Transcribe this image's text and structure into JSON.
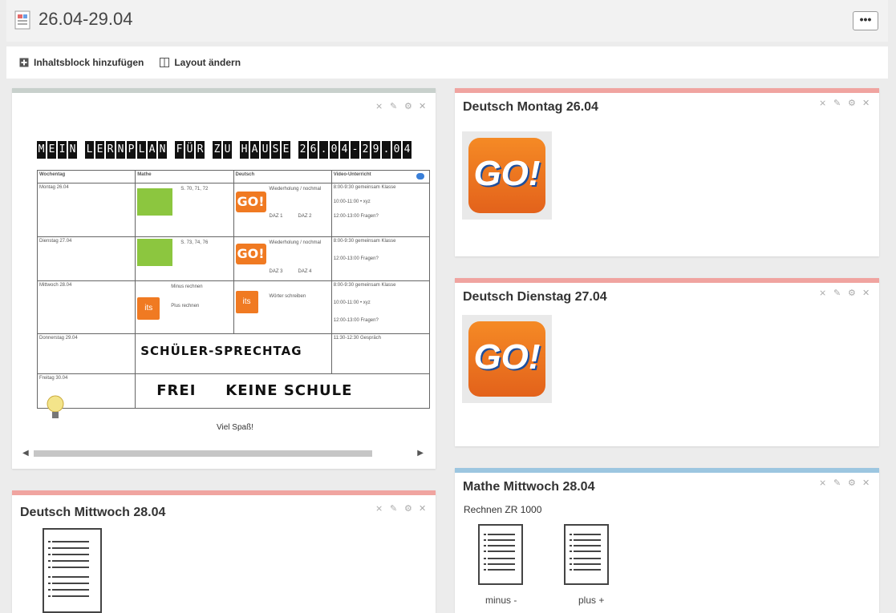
{
  "page": {
    "title": "26.04-29.04",
    "more_label": "•••"
  },
  "toolbar": {
    "add_block": "Inhaltsblock hinzufügen",
    "change_layout": "Layout ändern"
  },
  "colors": {
    "gray_bar": "#c8d0cc",
    "red_bar": "#f0a4a0",
    "blue_bar": "#9cc6e0",
    "orange": "#f07a22"
  },
  "plan_block": {
    "banner": [
      "M",
      "E",
      "I",
      "N",
      " ",
      "L",
      "E",
      "R",
      "N",
      "P",
      "L",
      "A",
      "N",
      " ",
      "F",
      "Ü",
      "R",
      " ",
      "Z",
      "U",
      " ",
      "H",
      "A",
      "U",
      "S",
      "E",
      " ",
      "2",
      "6",
      ".",
      "0",
      "4",
      "-",
      "2",
      "9",
      ".",
      "0",
      "4"
    ],
    "headers": [
      "Wochentag",
      "Mathe",
      "Deutsch",
      "Video-Unterricht"
    ],
    "rows": [
      {
        "day": "Montag 26.04",
        "mathe": "S. 70, 71, 72",
        "deutsch": "Wiederholung / nochmal",
        "daz": [
          "DAZ 1",
          "DAZ 2"
        ],
        "video": [
          "8:00-9:30 gemeinsam Klasse",
          "10:00-11:00 • xyz",
          "12:00-13:00 Fragen?"
        ]
      },
      {
        "day": "Dienstag 27.04",
        "mathe": "S. 73, 74, 76",
        "deutsch": "Wiederholung / nochmal",
        "daz": [
          "DAZ 3",
          "DAZ 4"
        ],
        "video": [
          "8:00-9:30 gemeinsam Klasse",
          "12:00-13:00 Fragen?"
        ]
      },
      {
        "day": "Mittwoch 28.04",
        "mathe_lines": [
          "Minus rechnen",
          "Plus rechnen"
        ],
        "deutsch": "Wörter schreiben",
        "video": [
          "8:00-9:30 gemeinsam Klasse",
          "10:00-11:00 • xyz",
          "12:00-13:00 Fragen?"
        ]
      },
      {
        "day": "Donnerstag 29.04",
        "big": "SCHÜLER-SPRECHTAG",
        "video": [
          "11:30-12:30 Gespräch"
        ]
      },
      {
        "day": "Freitag 30.04",
        "big_left": "FREI",
        "big_right": "KEINE SCHULE"
      }
    ],
    "footer": "Viel Spaß!",
    "go_label": "GO!",
    "its_label": "its",
    "tile_num": "2"
  },
  "blocks": {
    "deutsch_montag": {
      "title": "Deutsch Montag 26.04",
      "go_label": "GO!"
    },
    "deutsch_dienstag": {
      "title": "Deutsch Dienstag 27.04",
      "go_label": "GO!"
    },
    "deutsch_mittwoch": {
      "title": "Deutsch Mittwoch 28.04"
    },
    "mathe_mittwoch": {
      "title": "Mathe Mittwoch 28.04",
      "subtitle": "Rechnen ZR 1000",
      "files": [
        "minus -",
        "plus +"
      ]
    }
  },
  "icons": [
    "page-icon",
    "add-block-icon",
    "layout-icon",
    "move-icon",
    "edit-icon",
    "settings-icon",
    "close-icon",
    "document-icon"
  ]
}
